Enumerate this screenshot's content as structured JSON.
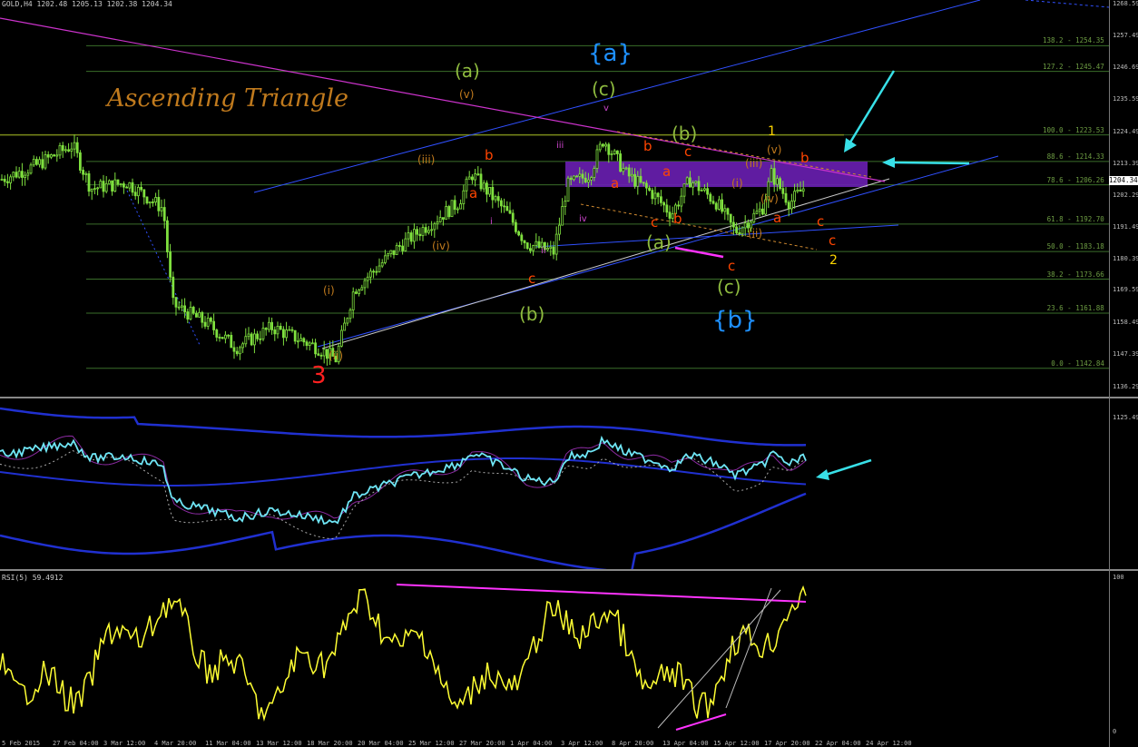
{
  "chart_data": {
    "type": "candlestick",
    "symbol_header": "GOLD,H4  1202.48 1205.13 1202.38 1204.34",
    "annotation_title": "Ascending Triangle",
    "price_axis_ticks": [
      "1268.59",
      "1257.49",
      "1246.69",
      "1235.59",
      "1224.49",
      "1213.39",
      "1202.29",
      "1191.49",
      "1180.39",
      "1169.59",
      "1158.49",
      "1147.39",
      "1136.29",
      "1125.49"
    ],
    "current_price": "1204.34",
    "fib_levels": [
      {
        "label": "138.2 - 1254.35"
      },
      {
        "label": "127.2 - 1245.47"
      },
      {
        "label": "100.0 - 1223.53"
      },
      {
        "label": "88.6 - 1214.33"
      },
      {
        "label": "78.6 - 1206.26"
      },
      {
        "label": "61.8 - 1192.70"
      },
      {
        "label": "50.0 - 1183.18"
      },
      {
        "label": "38.2 - 1173.66"
      },
      {
        "label": "23.6 - 1161.88"
      },
      {
        "label": "0.0 - 1142.84"
      }
    ],
    "time_axis_ticks": [
      "5 Feb 2015",
      "27 Feb 04:00",
      "3 Mar 12:00",
      "4 Mar 20:00",
      "11 Mar 04:00",
      "13 Mar 12:00",
      "18 Mar 20:00",
      "20 Mar 04:00",
      "25 Mar 12:00",
      "27 Mar 20:00",
      "1 Apr 04:00",
      "3 Apr 12:00",
      "8 Apr 20:00",
      "13 Apr 04:00",
      "15 Apr 12:00",
      "17 Apr 20:00",
      "22 Apr 04:00",
      "24 Apr 12:00"
    ],
    "wave_labels": [
      {
        "text": "{a}",
        "color": "#1e90ff"
      },
      {
        "text": "{b}",
        "color": "#1e90ff"
      },
      {
        "text": "(a)",
        "color": "#8fbc3f"
      },
      {
        "text": "(b)",
        "color": "#8fbc3f"
      },
      {
        "text": "(c)",
        "color": "#8fbc3f"
      },
      {
        "text": "3",
        "color": "#ff2020"
      },
      {
        "text": "1",
        "color": "#ffd700"
      },
      {
        "text": "2",
        "color": "#ffd700"
      },
      {
        "text": "(i)",
        "color": "#c07a1d"
      },
      {
        "text": "(ii)",
        "color": "#c07a1d"
      },
      {
        "text": "(iii)",
        "color": "#c07a1d"
      },
      {
        "text": "(iv)",
        "color": "#c07a1d"
      },
      {
        "text": "(v)",
        "color": "#c07a1d"
      },
      {
        "text": "a",
        "color": "#ff4500"
      },
      {
        "text": "b",
        "color": "#ff4500"
      },
      {
        "text": "c",
        "color": "#ff4500"
      },
      {
        "text": "i",
        "color": "#cc44cc"
      },
      {
        "text": "ii",
        "color": "#cc44cc"
      },
      {
        "text": "iii",
        "color": "#cc44cc"
      },
      {
        "text": "iv",
        "color": "#cc44cc"
      },
      {
        "text": "v",
        "color": "#cc44cc"
      }
    ],
    "rsi_header": "RSI(5) 59.4912",
    "rsi_axis_ticks": [
      "100",
      "0"
    ],
    "colors": {
      "background": "#000000",
      "candle": "#7fe03f",
      "fib_line": "#3a6e2a",
      "resistance_zone": "#6a1fb3",
      "channel_line": "#3050ff",
      "trendline_magenta": "#cc33cc",
      "ind_cyan": "#6fe6f6",
      "rsi_line": "#ffff33",
      "arrow": "#38e0e8"
    }
  }
}
